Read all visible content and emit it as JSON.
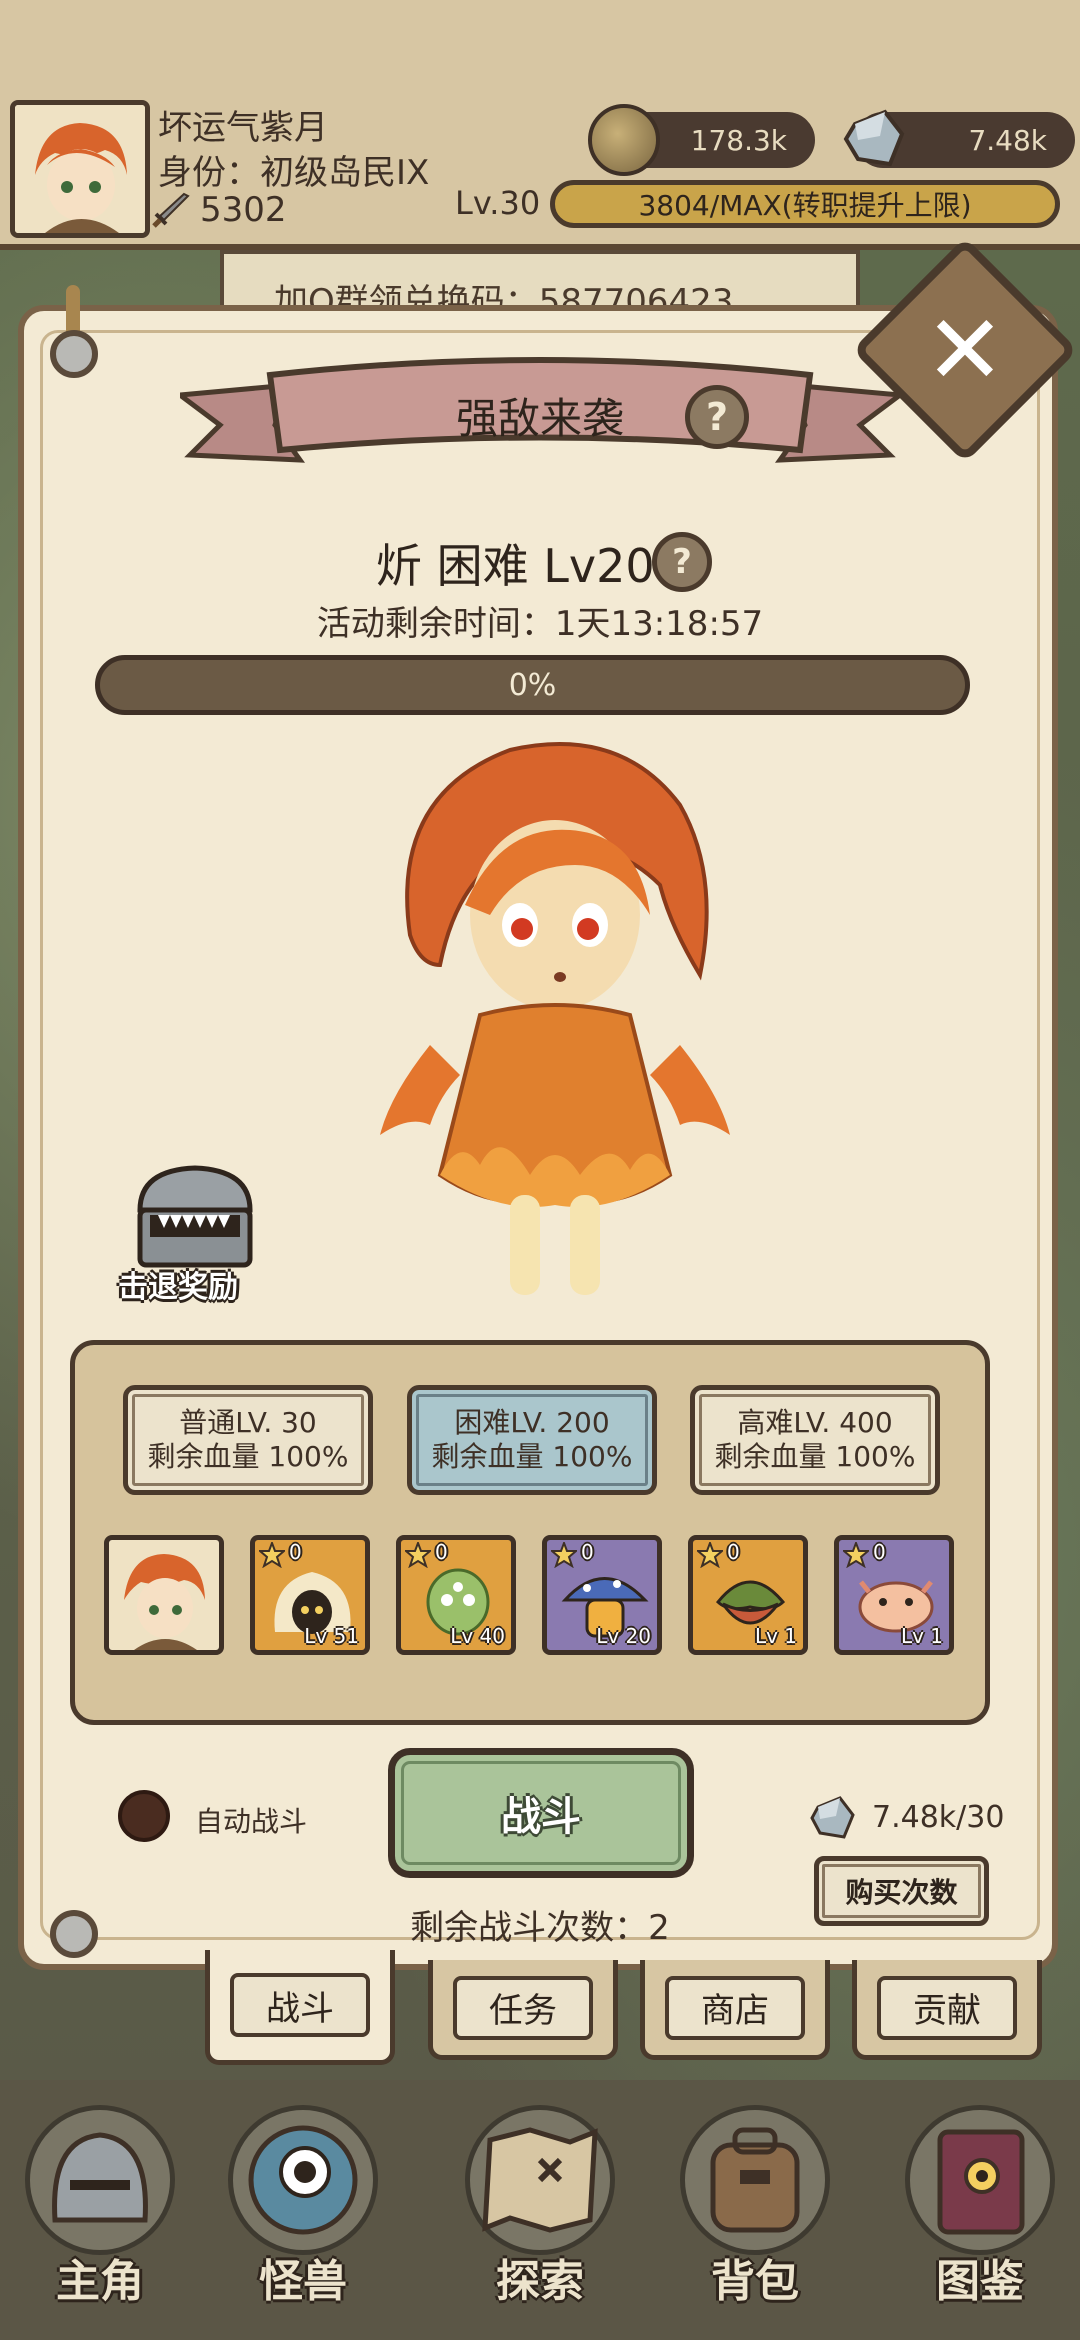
{
  "player": {
    "name": "坏运气紫月",
    "rank": "身份：初级岛民IX",
    "power": "5302",
    "level": "Lv.30",
    "xp": "3804/MAX(转职提升上限)"
  },
  "resources": {
    "coins": "178.3k",
    "gems": "7.48k"
  },
  "background_sign": "加Q群领兑换码：587706423",
  "event": {
    "title": "强敌来袭",
    "boss_title": "炘 困难 Lv200",
    "countdown": "活动剩余时间：1天13:18:57",
    "hp_percent": "0%",
    "hp_fraction": 0
  },
  "chest": {
    "label": "击退奖励"
  },
  "difficulties": [
    {
      "line1": "普通LV. 30",
      "line2": "剩余血量 100%"
    },
    {
      "line1": "困难LV. 200",
      "line2": "剩余血量 100%"
    },
    {
      "line1": "高难LV. 400",
      "line2": "剩余血量 100%"
    }
  ],
  "team": [
    {
      "stars": "0",
      "level": "Lv 51"
    },
    {
      "stars": "0",
      "level": "Lv 40"
    },
    {
      "stars": "0",
      "level": "Lv 20"
    },
    {
      "stars": "0",
      "level": "Lv 1"
    },
    {
      "stars": "0",
      "level": "Lv 1"
    }
  ],
  "controls": {
    "auto_label": "自动战斗",
    "fight_label": "战斗",
    "tickets": "7.48k/30",
    "buy_label": "购买次数",
    "remaining": "剩余战斗次数：2"
  },
  "tabs": [
    "战斗",
    "任务",
    "商店",
    "贡献"
  ],
  "nav": [
    "主角",
    "怪兽",
    "探索",
    "背包",
    "图鉴"
  ],
  "colors": {
    "panel": "#f3ead4",
    "border": "#4a3a2c",
    "hard_selected": "#aac6cc",
    "fight_button": "#aac49a",
    "xp_bar": "#c9a44a"
  }
}
